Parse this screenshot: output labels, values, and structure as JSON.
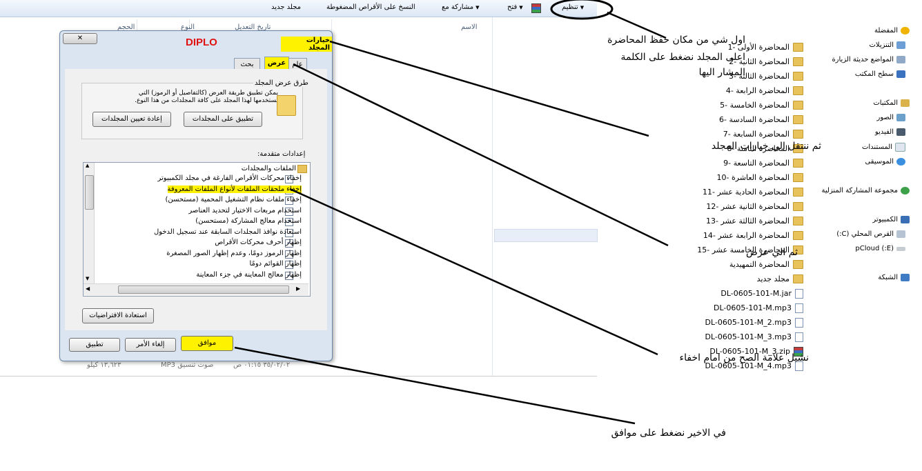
{
  "toolbar": {
    "organize": "تنظيم",
    "open": "فتح",
    "share_with": "مشاركة مع",
    "burn": "النسخ على الأقراص المضغوطة",
    "new_folder": "مجلد جديد"
  },
  "columns": {
    "name": "الاسم",
    "date_modified": "تاريخ التعديل",
    "type": "النوع",
    "size": "الحجم"
  },
  "nav": {
    "favorites": "المفضلة",
    "downloads": "التنزيلات",
    "recent_places": "المواضع حديثة الزيارة",
    "desktop": "سطح المكتب",
    "libraries": "المكتبات",
    "pictures": "الصور",
    "videos": "الفيديو",
    "documents": "المستندات",
    "music": "الموسيقى",
    "homegroup": "مجموعة المشاركة المنزلية",
    "computer": "الكمبيوتر",
    "local_disk": "القرص المحلي (C:)",
    "pcloud": "(E:) pCloud",
    "network": "الشبكة"
  },
  "files": [
    {
      "name": "المحاضرة الأولى -1",
      "kind": "folder"
    },
    {
      "name": "المحاضرة الثانية -2",
      "kind": "folder"
    },
    {
      "name": "المحاضرة الثالثة -3",
      "kind": "folder"
    },
    {
      "name": "المحاضرة الرابعة -4",
      "kind": "folder"
    },
    {
      "name": "المحاضرة الخامسة -5",
      "kind": "folder"
    },
    {
      "name": "المحاضرة السادسة -6",
      "kind": "folder"
    },
    {
      "name": "المحاضرة السابعة -7",
      "kind": "folder"
    },
    {
      "name": "المحاضرة الثامنة -8",
      "kind": "folder"
    },
    {
      "name": "المحاضرة التاسعة -9",
      "kind": "folder"
    },
    {
      "name": "المحاضرة العاشرة -10",
      "kind": "folder"
    },
    {
      "name": "المحاضرة الحادية عشر -11",
      "kind": "folder"
    },
    {
      "name": "المحاضرة الثانية عشر -12",
      "kind": "folder"
    },
    {
      "name": "المحاضرة الثالثة عشر -13",
      "kind": "folder"
    },
    {
      "name": "المحاضرة الرابعة عشر -14",
      "kind": "folder"
    },
    {
      "name": "المحاضرة الخامسة عشر -15",
      "kind": "folder"
    },
    {
      "name": "المحاضرة التمهيدية",
      "kind": "folder"
    },
    {
      "name": "مجلد جديد",
      "kind": "folder"
    },
    {
      "name": "DL-0605-101-M.jar",
      "kind": "file"
    },
    {
      "name": "DL-0605-101-M.mp3",
      "kind": "file"
    },
    {
      "name": "DL-0605-101-M_2.mp3",
      "kind": "file"
    },
    {
      "name": "DL-0605-101-M_3.mp3",
      "kind": "file"
    },
    {
      "name": "DL-0605-101-M_3.zip",
      "kind": "zip"
    },
    {
      "name": "DL-0605-101-M_4.mp3",
      "kind": "file"
    }
  ],
  "bottom_row": {
    "date": "٣٥/٠٢/٠٢ ٠١:١٥ ص",
    "type": "صوت تنسيق MP3",
    "size": "١٣,٦٢٣ كيلو"
  },
  "dialog": {
    "title": "خيارات المجلد",
    "watermark": "DIPLO",
    "close": "✕",
    "tabs": {
      "general": "عام",
      "view": "عرض",
      "search": "بحث"
    },
    "folder_views_label": "طرق عرض المجلد",
    "folder_views_desc_1": "يمكن تطبيق طريقة العرض (كالتفاصيل أو الرموز) التي",
    "folder_views_desc_2": "تستخدمها لهذا المجلد على كافة المجلدات من هذا النوع.",
    "apply_to_folders": "تطبيق على المجلدات",
    "reset_folders": "إعادة تعيين المجلدات",
    "advanced_label": "إعدادات متقدمة:",
    "tree_root": "الملفات والمجلدات",
    "settings": [
      {
        "label": "إخفاء محركات الأقراص الفارغة في مجلد الكمبيوتر",
        "checked": "✓"
      },
      {
        "label": "إخفاء ملحقات الملفات لأنواع الملفات المعروفة",
        "checked": ""
      },
      {
        "label": "إخفاء ملفات نظام التشغيل المحمية (مستحسن)",
        "checked": ""
      },
      {
        "label": "استخدام مربعات الاختيار لتحديد العناصر",
        "checked": ""
      },
      {
        "label": "استخدام معالج المشاركة (مستحسن)",
        "checked": "✓"
      },
      {
        "label": "استعادة نوافذ المجلدات السابقة عند تسجيل الدخول",
        "checked": ""
      },
      {
        "label": "إظهار أحرف محركات الأقراص",
        "checked": "✓"
      },
      {
        "label": "إظهار الرموز دومًا، وعدم إظهار الصور المصغرة",
        "checked": ""
      },
      {
        "label": "إظهار القوائم دومًا",
        "checked": ""
      },
      {
        "label": "إظهار معالج المعاينة في جزء المعاينة",
        "checked": "✓"
      }
    ],
    "restore_defaults": "استعادة الافتراضيات",
    "ok": "موافق",
    "cancel": "إلغاء الأمر",
    "apply": "تطبيق"
  },
  "annotations": {
    "step1_line1": "اول شي من مكان حفظ المحاضرة",
    "step1_line2": "اعلى المجلد نضغط على الكلمة",
    "step1_line3": "المشار اليها",
    "step2": "ثم ننتقل الي خيارات المجلد",
    "step3": "ثم الي عرض",
    "step4": "نشيل علامة الصح من امام اخفاء",
    "step5": "في الاخير نضغط على موافق"
  }
}
